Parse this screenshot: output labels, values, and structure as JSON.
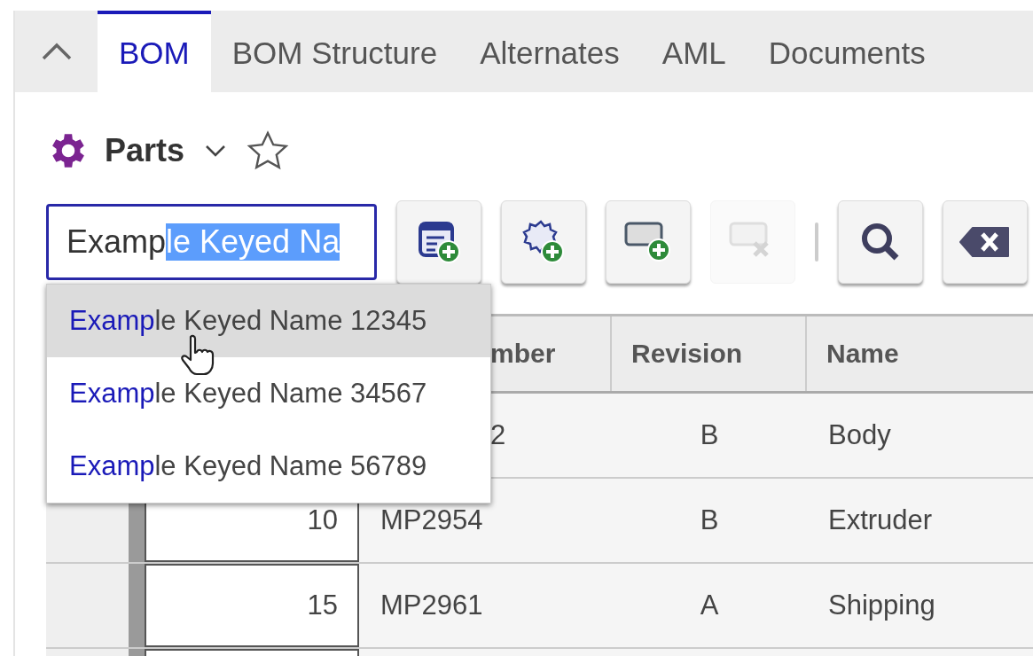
{
  "tabs": [
    {
      "label": "BOM",
      "selected": true
    },
    {
      "label": "BOM Structure",
      "selected": false
    },
    {
      "label": "Alternates",
      "selected": false
    },
    {
      "label": "AML",
      "selected": false
    },
    {
      "label": "Documents",
      "selected": false
    }
  ],
  "title": "Parts",
  "favorite": false,
  "search": {
    "typed": "Examp",
    "selected_text": "le Keyed Na"
  },
  "toolbar": [
    {
      "kind": "add-grid",
      "disabled": false
    },
    {
      "kind": "add-item",
      "disabled": false
    },
    {
      "kind": "add-row",
      "disabled": false
    },
    {
      "kind": "remove-row",
      "disabled": true
    },
    {
      "kind": "separator"
    },
    {
      "kind": "search",
      "disabled": false
    },
    {
      "kind": "clear",
      "disabled": false
    }
  ],
  "suggestions": [
    {
      "match": "Examp",
      "rest": "le Keyed Name 12345",
      "selected": true
    },
    {
      "match": "Examp",
      "rest": "le Keyed Name 34567",
      "selected": false
    },
    {
      "match": "Examp",
      "rest": "le Keyed Name 56789",
      "selected": false
    }
  ],
  "table": {
    "columns": [
      {
        "label": "mber"
      },
      {
        "label": "Revision"
      },
      {
        "label": "Name"
      }
    ],
    "rows": [
      {
        "part_number": "2",
        "revision": "B",
        "name": "Body"
      },
      {
        "sequence": "10",
        "part_number": "MP2954",
        "revision": "B",
        "name": "Extruder"
      },
      {
        "sequence": "15",
        "part_number": "MP2961",
        "revision": "A",
        "name": "Shipping"
      }
    ]
  }
}
